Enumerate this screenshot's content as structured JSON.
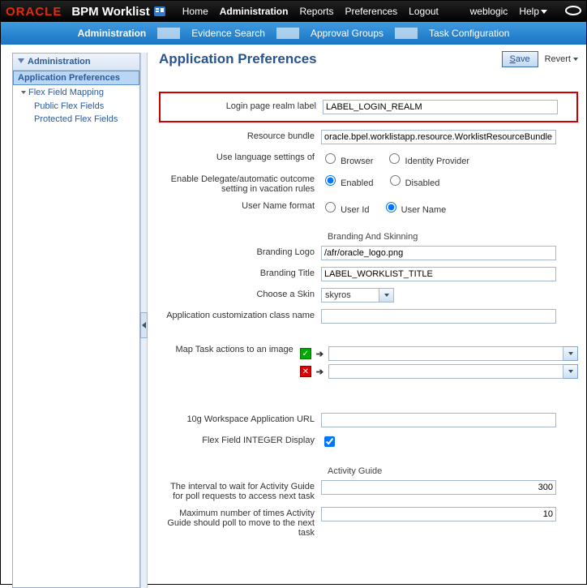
{
  "brand": {
    "logo_text": "ORACLE",
    "app_title": "BPM Worklist"
  },
  "topnav": {
    "home": "Home",
    "admin": "Administration",
    "reports": "Reports",
    "prefs": "Preferences",
    "logout": "Logout"
  },
  "toputil": {
    "user": "weblogic",
    "help": "Help"
  },
  "subnav": {
    "admin": "Administration",
    "evidence": "Evidence Search",
    "approval": "Approval Groups",
    "taskcfg": "Task Configuration"
  },
  "sidebar": {
    "head": "Administration",
    "item_prefs": "Application Preferences",
    "item_flex": "Flex Field Mapping",
    "sub_public": "Public Flex Fields",
    "sub_protected": "Protected Flex Fields"
  },
  "page": {
    "title": "Application Preferences",
    "save": "Save",
    "revert": "Revert"
  },
  "fields": {
    "login_realm_lbl": "Login page realm label",
    "login_realm_val": "LABEL_LOGIN_REALM",
    "res_bundle_lbl": "Resource bundle",
    "res_bundle_val": "oracle.bpel.worklistapp.resource.WorklistResourceBundle",
    "lang_lbl": "Use language settings of",
    "lang_browser": "Browser",
    "lang_idp": "Identity Provider",
    "delegate_lbl": "Enable Delegate/automatic outcome setting in vacation rules",
    "delegate_enabled": "Enabled",
    "delegate_disabled": "Disabled",
    "uname_lbl": "User Name format",
    "uname_id": "User Id",
    "uname_name": "User Name",
    "branding_head": "Branding And Skinning",
    "brand_logo_lbl": "Branding Logo",
    "brand_logo_val": "/afr/oracle_logo.png",
    "brand_title_lbl": "Branding Title",
    "brand_title_val": "LABEL_WORKLIST_TITLE",
    "skin_lbl": "Choose a Skin",
    "skin_val": "skyros",
    "cust_class_lbl": "Application customization class name",
    "cust_class_val": "",
    "map_task_lbl": "Map Task actions to an image",
    "tenG_lbl": "10g Workspace Application URL",
    "tenG_val": "",
    "flex_int_lbl": "Flex Field INTEGER Display",
    "activity_head": "Activity Guide",
    "ag_interval_lbl": "The interval to wait for Activity Guide for poll requests to access next task",
    "ag_interval_val": "300",
    "ag_max_lbl": "Maximum number of times Activity Guide should poll to move to the next task",
    "ag_max_val": "10"
  }
}
